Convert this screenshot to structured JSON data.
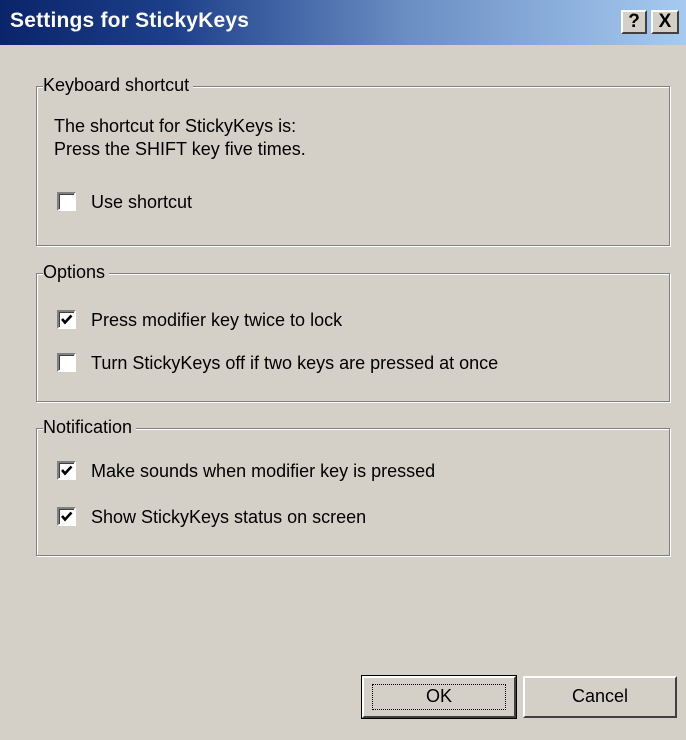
{
  "window": {
    "title": "Settings for StickyKeys",
    "help_button": "?",
    "close_button": "X"
  },
  "keyboard_shortcut": {
    "legend": "Keyboard shortcut",
    "description_line1": "The shortcut for StickyKeys is:",
    "description_line2": "Press the SHIFT key five times.",
    "use_shortcut": {
      "label": "Use shortcut",
      "checked": false
    }
  },
  "options": {
    "legend": "Options",
    "items": [
      {
        "label": "Press modifier key twice to lock",
        "checked": true
      },
      {
        "label": "Turn StickyKeys off if two keys are pressed at once",
        "checked": false
      }
    ]
  },
  "notification": {
    "legend": "Notification",
    "items": [
      {
        "label": "Make sounds when modifier key is pressed",
        "checked": true
      },
      {
        "label": "Show StickyKeys status on screen",
        "checked": true
      }
    ]
  },
  "buttons": {
    "ok_label": "OK",
    "cancel_label": "Cancel"
  }
}
